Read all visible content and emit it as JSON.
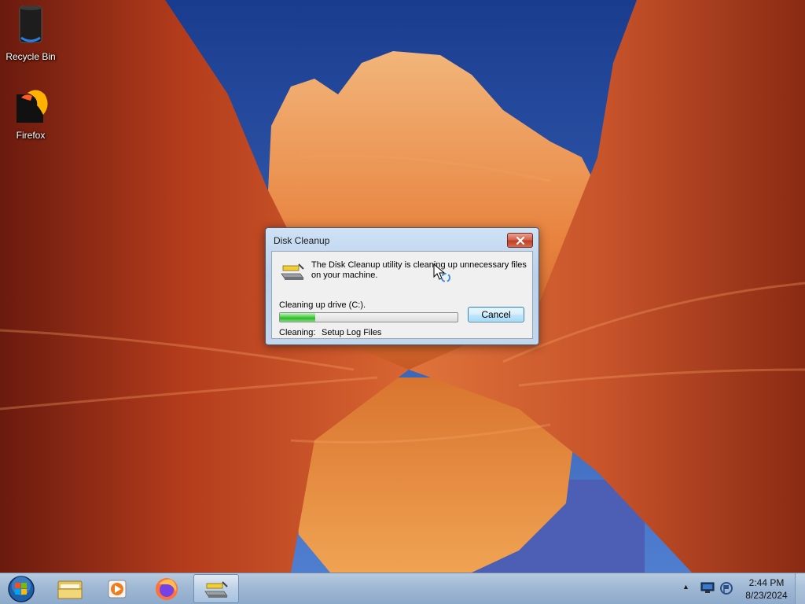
{
  "desktop": {
    "icons": [
      {
        "label": "Recycle Bin",
        "icon": "recycle-bin-icon"
      },
      {
        "label": "Firefox",
        "icon": "firefox-icon"
      }
    ]
  },
  "dialog": {
    "title": "Disk Cleanup",
    "message": "The Disk Cleanup utility is cleaning up unnecessary files on your machine.",
    "drive_label": "Cleaning up drive  (C:).",
    "progress": 0.2,
    "cancel_label": "Cancel",
    "cleaning_label": "Cleaning:",
    "cleaning_item": "Setup Log Files"
  },
  "taskbar": {
    "start_icon": "windows-start-icon",
    "pinned": [
      "folder-icon",
      "media-player-icon",
      "firefox-icon",
      "disk-cleanup-icon"
    ],
    "active": "disk-cleanup-icon",
    "clock": {
      "time": "2:44 PM",
      "date": "8/23/2024"
    }
  },
  "colors": {
    "progress": "#3cc537",
    "close_button": "#c94a33",
    "dialog_frame": "#c2d7ee",
    "taskbar": "#a6bfd9"
  }
}
